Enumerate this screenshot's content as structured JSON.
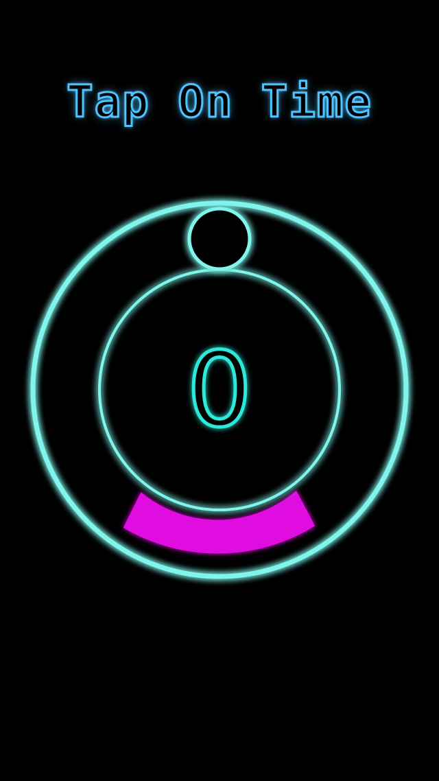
{
  "game": {
    "title": "Tap On Time",
    "score": "0"
  },
  "colors": {
    "background": "#000000",
    "title_neon": "#4fc3ff",
    "ring_neon": "#7ff5ec",
    "target_zone": "#e010e0"
  }
}
